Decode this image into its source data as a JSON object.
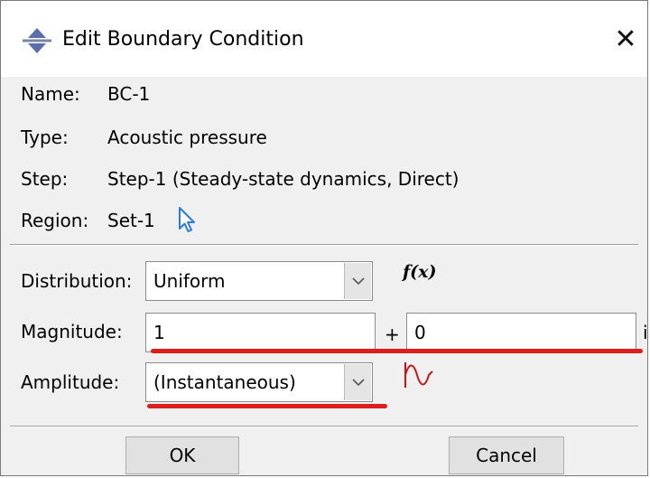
{
  "window": {
    "title": "Edit Boundary Condition",
    "title_icon": "bc-arrows-icon",
    "close_glyph": "✕"
  },
  "info": {
    "name_label": "Name:",
    "name_value": "BC-1",
    "type_label": "Type:",
    "type_value": "Acoustic pressure",
    "step_label": "Step:",
    "step_value": "Step-1 (Steady-state dynamics, Direct)",
    "region_label": "Region:",
    "region_value": "Set-1",
    "region_edit_icon": "select-arrow-icon"
  },
  "form": {
    "distribution_label": "Distribution:",
    "distribution_value": "Uniform",
    "fx_label": "f(x)",
    "magnitude_label": "Magnitude:",
    "magnitude_real": "1",
    "plus_sign": "+",
    "magnitude_imag": "0",
    "imag_suffix": "i",
    "amplitude_label": "Amplitude:",
    "amplitude_value": "(Instantaneous)",
    "amplitude_icon": "amplitude-curve-icon"
  },
  "buttons": {
    "ok_label": "OK",
    "cancel_label": "Cancel"
  },
  "colors": {
    "annotation_red": "#dc1e1e",
    "cursor_blue": "#2a7ae2",
    "amplitude_red": "#c81414"
  }
}
